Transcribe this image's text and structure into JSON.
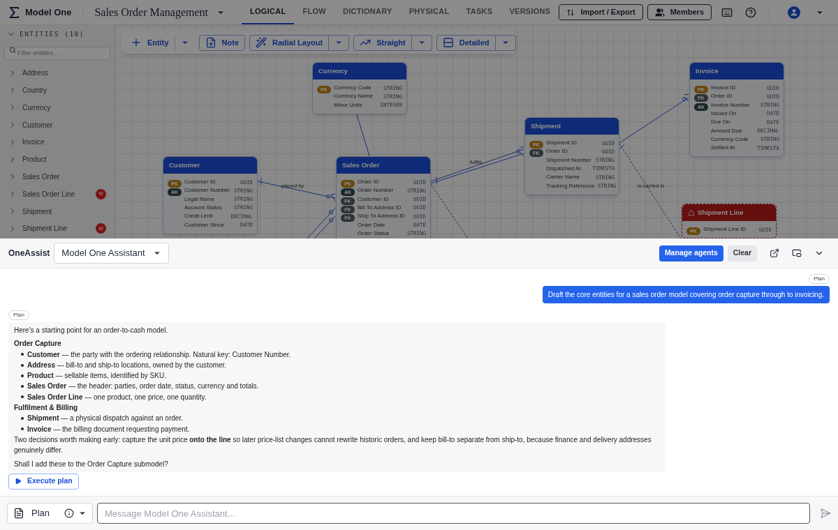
{
  "app": {
    "name": "Model One",
    "project": "Sales Order Management"
  },
  "tabs": [
    {
      "label": "LOGICAL",
      "selected": true
    },
    {
      "label": "FLOW",
      "selected": false
    },
    {
      "label": "DICTIONARY",
      "selected": false
    },
    {
      "label": "PHYSICAL",
      "selected": false
    },
    {
      "label": "TASKS",
      "selected": false
    },
    {
      "label": "VERSIONS",
      "selected": false
    }
  ],
  "header_actions": [
    {
      "label": "Import / Export",
      "kind": "import"
    },
    {
      "label": "Members",
      "kind": "members"
    }
  ],
  "sidebar": {
    "title": "ENTITIES (10)",
    "filter_placeholder": "Filter entities...",
    "items": [
      {
        "label": "Address"
      },
      {
        "label": "Country"
      },
      {
        "label": "Currency"
      },
      {
        "label": "Customer"
      },
      {
        "label": "Invoice"
      },
      {
        "label": "Product"
      },
      {
        "label": "Sales Order"
      },
      {
        "label": "Sales Order Line",
        "badge": "W"
      },
      {
        "label": "Shipment"
      },
      {
        "label": "Shipment Line",
        "badge": "W"
      }
    ]
  },
  "toolbar": [
    {
      "label": "Entity",
      "kind": "add",
      "split": true
    },
    {
      "label": "Note",
      "kind": "note",
      "split": false
    },
    {
      "label": "Radial Layout",
      "kind": "layout",
      "split": true
    },
    {
      "label": "Straight",
      "kind": "line",
      "split": true
    },
    {
      "label": "Detailed",
      "kind": "detail",
      "split": true
    }
  ],
  "canvas": {
    "entities": [
      {
        "name": "Currency",
        "warning": false,
        "rows": [
          {
            "name": "Currency Code",
            "type": "STRING",
            "key": "PK"
          },
          {
            "name": "Currency Name",
            "type": "STRING"
          },
          {
            "name": "Minor Units",
            "type": "INTEGER"
          }
        ]
      },
      {
        "name": "Customer",
        "warning": false,
        "rows": [
          {
            "name": "Customer ID",
            "type": "UUID",
            "key": "PK"
          },
          {
            "name": "Customer Number",
            "type": "STRING",
            "key": "AK"
          },
          {
            "name": "Legal Name",
            "type": "STRING"
          },
          {
            "name": "Account Status",
            "type": "STRING"
          },
          {
            "name": "Credit Limit",
            "type": "DECIMAL"
          },
          {
            "name": "Customer Since",
            "type": "DATE"
          }
        ]
      },
      {
        "name": "Sales Order",
        "warning": false,
        "rows": [
          {
            "name": "Order ID",
            "type": "UUID",
            "key": "PK"
          },
          {
            "name": "Order Number",
            "type": "STRING",
            "key": "AK"
          },
          {
            "name": "Customer ID",
            "type": "UUID",
            "key": "FK"
          },
          {
            "name": "Bill To Address ID",
            "type": "UUID",
            "key": "FK"
          },
          {
            "name": "Ship To Address ID",
            "type": "UUID",
            "key": "FK"
          },
          {
            "name": "Order Date",
            "type": "DATE"
          },
          {
            "name": "Order Status",
            "type": "STRING"
          }
        ]
      },
      {
        "name": "Shipment",
        "warning": false,
        "rows": [
          {
            "name": "Shipment ID",
            "type": "UUID",
            "key": "PK"
          },
          {
            "name": "Order ID",
            "type": "UUID",
            "key": "FK"
          },
          {
            "name": "Shipment Number",
            "type": "STRING"
          },
          {
            "name": "Dispatched At",
            "type": "TIMESTA"
          },
          {
            "name": "Carrier Name",
            "type": "STRING"
          },
          {
            "name": "Tracking Reference",
            "type": "STRING"
          }
        ]
      },
      {
        "name": "Invoice",
        "warning": false,
        "rows": [
          {
            "name": "Invoice ID",
            "type": "UUID",
            "key": "PK"
          },
          {
            "name": "Order ID",
            "type": "UUID",
            "key": "FK"
          },
          {
            "name": "Invoice Number",
            "type": "STRING",
            "key": "AK"
          },
          {
            "name": "Issued On",
            "type": "DATE"
          },
          {
            "name": "Due On",
            "type": "DATE"
          },
          {
            "name": "Amount Due",
            "type": "DECIMAL"
          },
          {
            "name": "Currency Code",
            "type": "STRING"
          },
          {
            "name": "Settled At",
            "type": "TIMESTA"
          }
        ]
      },
      {
        "name": "Shipment Line",
        "warning": true,
        "rows": [
          {
            "name": "Shipment Line ID",
            "type": "UUID",
            "key": "PK"
          }
        ]
      }
    ],
    "edge_labels": [
      "placed by",
      "fulfils",
      "is carried in"
    ]
  },
  "assistant": {
    "title": "OneAssist",
    "agent": "Model One Assistant",
    "buttons": [
      {
        "label": "Manage agents",
        "kind": "primary"
      },
      {
        "label": "Clear",
        "kind": "secondary"
      }
    ]
  },
  "messages": [
    {
      "kind": "user",
      "badge": "Plan",
      "text": "Draft the core entities for a sales order model covering order capture through to invoicing."
    },
    {
      "kind": "assistant",
      "badge": "Plan",
      "blocks": [
        {
          "kind": "paragraph",
          "text": "Here's a starting point for an order-to-cash model."
        },
        {
          "kind": "heading",
          "text": "Order Capture"
        },
        {
          "kind": "bullet",
          "text": "**Customer** — the party with the ordering relationship. Natural key: Customer Number."
        },
        {
          "kind": "bullet",
          "text": "**Address** — bill-to and ship-to locations, owned by the customer."
        },
        {
          "kind": "bullet",
          "text": "**Product** — sellable items, identified by SKU."
        },
        {
          "kind": "bullet",
          "text": "**Sales Order** — the header: parties, order date, status, currency and totals."
        },
        {
          "kind": "bullet",
          "text": "**Sales Order Line** — one product, one price, one quantity."
        },
        {
          "kind": "heading",
          "text": "Fulfilment & Billing"
        },
        {
          "kind": "bullet",
          "text": "**Shipment** — a physical dispatch against an order."
        },
        {
          "kind": "bullet",
          "text": "**Invoice** — the billing document requesting payment."
        },
        {
          "kind": "paragraph",
          "text": "Two decisions worth making early: capture the unit price **onto the line** so later price-list changes cannot rewrite historic orders, and keep bill-to separate from ship-to, because finance and delivery addresses genuinely differ."
        },
        {
          "kind": "spaced",
          "text": "Shall I add these to the Order Capture submodel?"
        }
      ]
    }
  ],
  "execute_button": "Execute plan",
  "composer": {
    "mode": "Plan",
    "placeholder": "Message Model One Assistant..."
  }
}
